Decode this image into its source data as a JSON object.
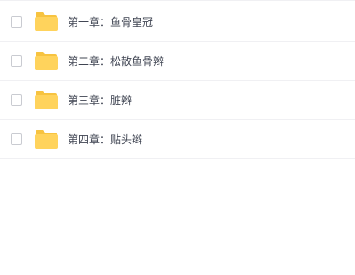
{
  "files": [
    {
      "name": "第一章：鱼骨皇冠",
      "icon": "folder-icon",
      "checked": false
    },
    {
      "name": "第二章：松散鱼骨辫",
      "icon": "folder-icon",
      "checked": false
    },
    {
      "name": "第三章：脏辫",
      "icon": "folder-icon",
      "checked": false
    },
    {
      "name": "第四章：贴头辫",
      "icon": "folder-icon",
      "checked": false
    }
  ],
  "colors": {
    "folder_body": "#ffd35c",
    "folder_tab": "#f7c340",
    "text": "#3f4452",
    "divider": "#f0f0f3",
    "checkbox_border": "#c9cbd1"
  }
}
